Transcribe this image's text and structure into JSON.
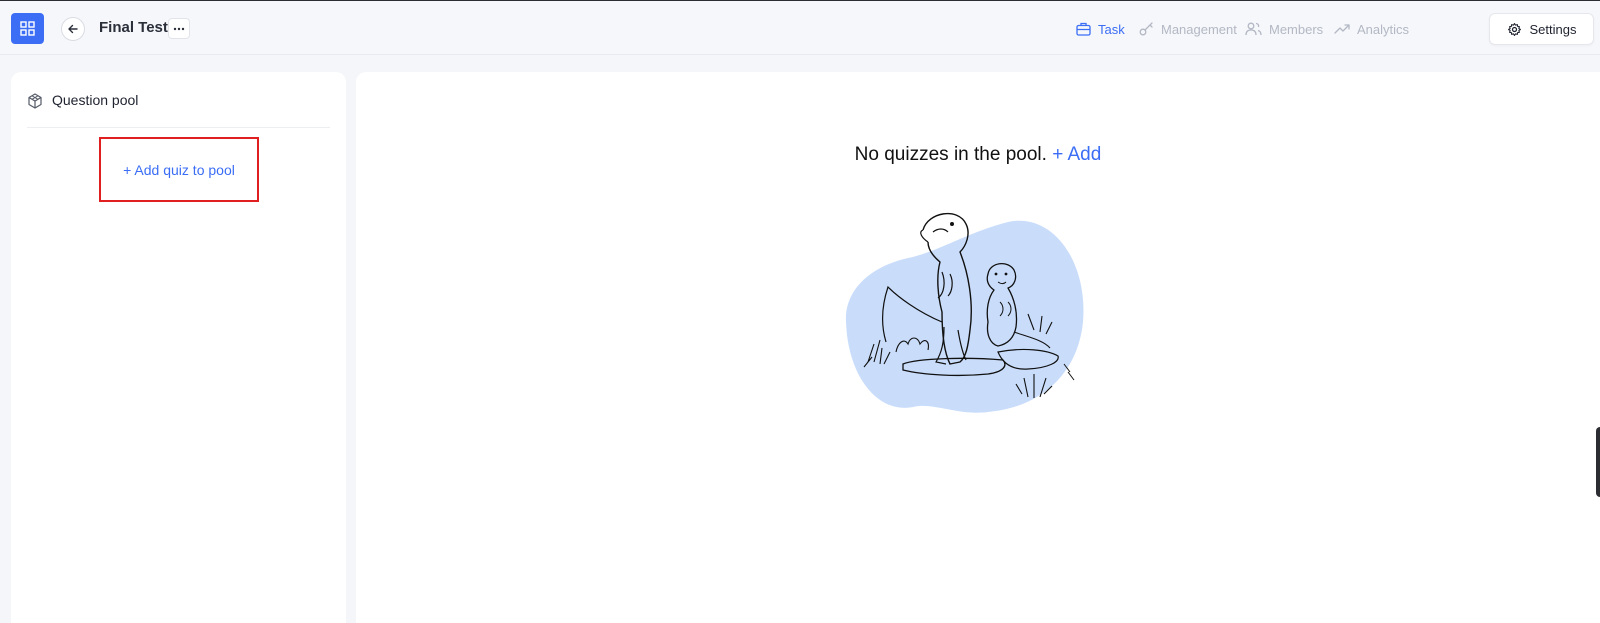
{
  "header": {
    "title": "Final Test",
    "nav": {
      "task": "Task",
      "management": "Management",
      "members": "Members",
      "analytics": "Analytics"
    },
    "settings_label": "Settings"
  },
  "left_panel": {
    "title": "Question pool",
    "add_quiz_label": "+ Add quiz to pool"
  },
  "main": {
    "empty_message": "No quizzes in the pool.",
    "add_label": "+ Add"
  },
  "colors": {
    "accent": "#3b6ef5",
    "highlight_box": "#e02020",
    "illustration_blob": "#c9ddfb"
  }
}
